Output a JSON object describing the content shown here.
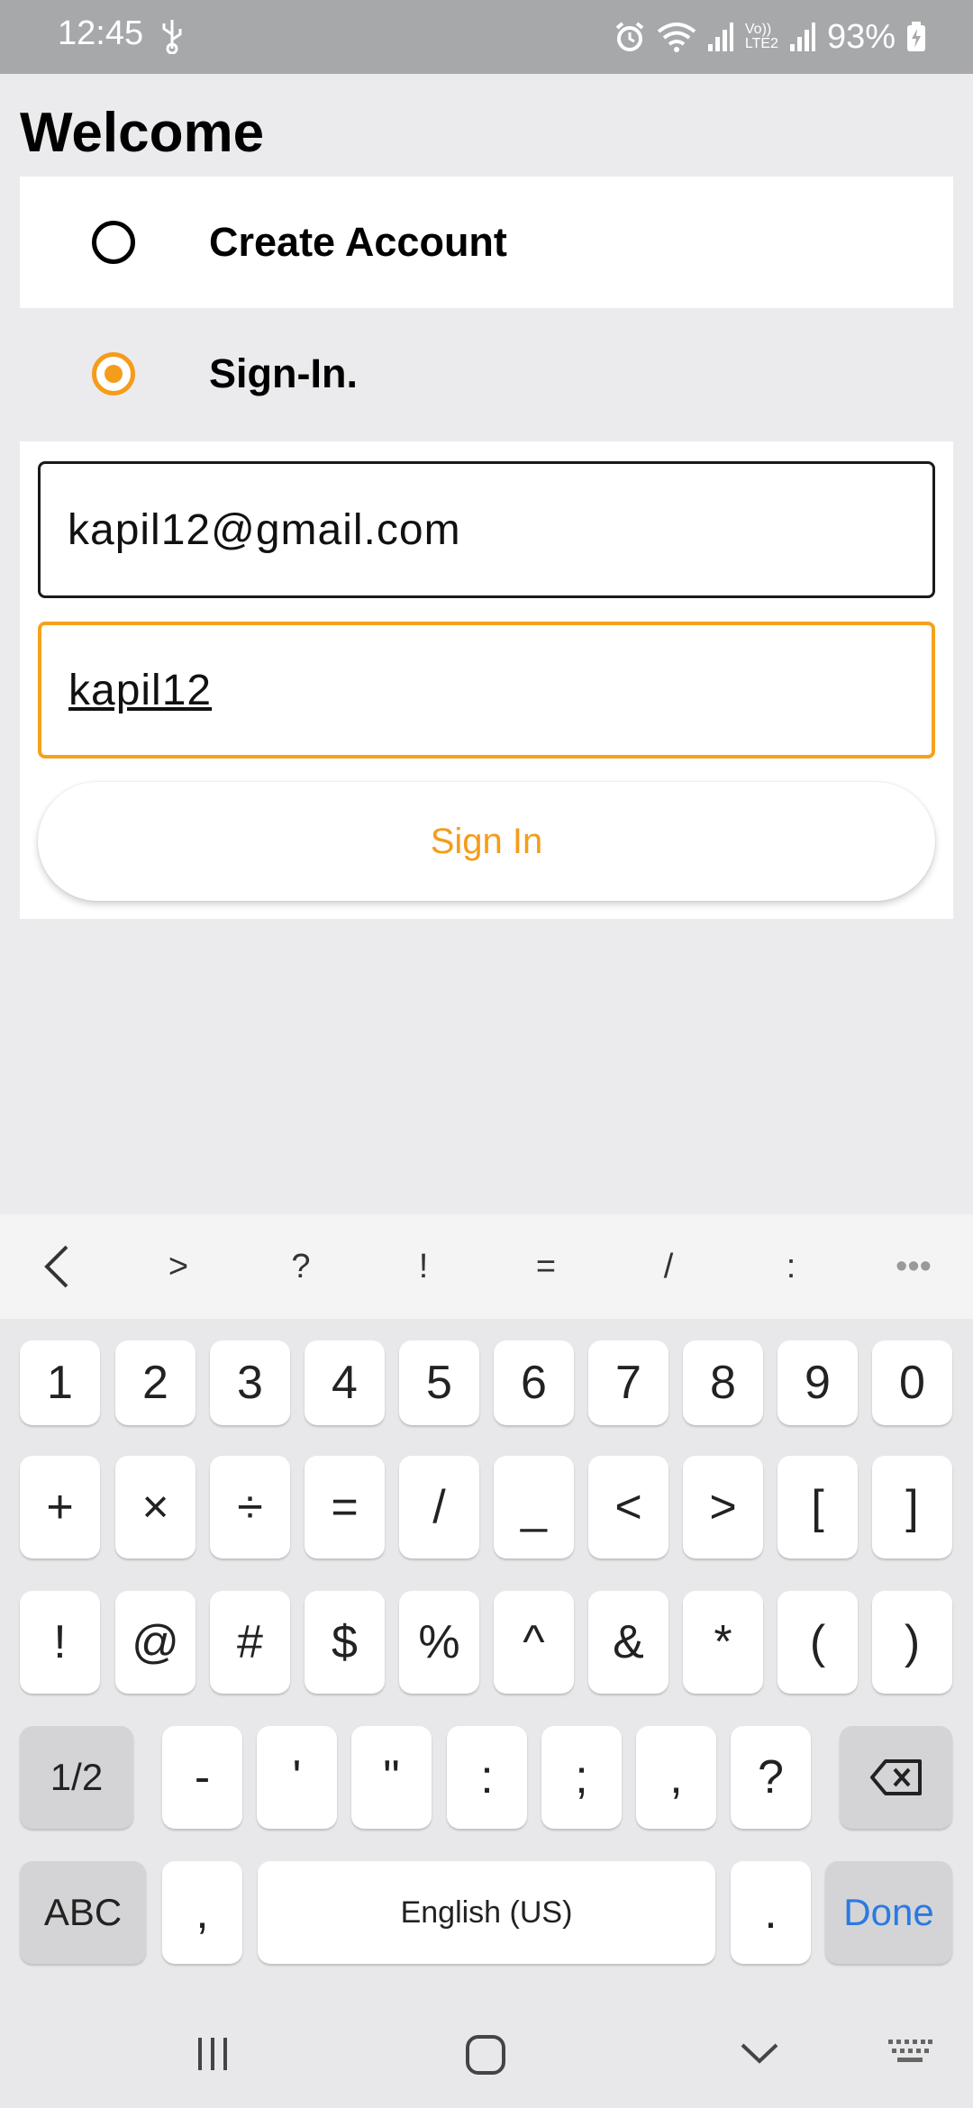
{
  "status_bar": {
    "time": "12:45",
    "battery_percent": "93%",
    "icons": [
      "usb-icon",
      "alarm-icon",
      "wifi-icon",
      "signal-icon",
      "volte-icon",
      "signal-icon",
      "battery-charging-icon"
    ],
    "volte_label": "Vo))",
    "lte_label": "LTE2"
  },
  "page": {
    "title": "Welcome"
  },
  "options": {
    "create_account": {
      "label": "Create Account",
      "selected": false
    },
    "sign_in": {
      "label": "Sign-In.",
      "selected": true
    }
  },
  "form": {
    "email_value": "kapil12@gmail.com",
    "password_value": "kapil12",
    "submit_label": "Sign In"
  },
  "colors": {
    "accent": "#f59c1a",
    "status_bar_bg": "#a7a8aa",
    "page_bg": "#ebebed",
    "keyboard_action": "#2a7ae2"
  },
  "keyboard": {
    "suggestions": [
      "<",
      ">",
      "?",
      "!",
      "=",
      "/",
      ":",
      "•••"
    ],
    "row1": [
      "1",
      "2",
      "3",
      "4",
      "5",
      "6",
      "7",
      "8",
      "9",
      "0"
    ],
    "row2": [
      "+",
      "×",
      "÷",
      "=",
      "/",
      "_",
      "<",
      ">",
      "[",
      "]"
    ],
    "row3": [
      "!",
      "@",
      "#",
      "$",
      "%",
      "^",
      "&",
      "*",
      "(",
      ")"
    ],
    "row4": [
      "1/2",
      "-",
      "'",
      "\"",
      ":",
      ";",
      ",",
      "?"
    ],
    "row5": {
      "abc": "ABC",
      "comma": ",",
      "space": "English (US)",
      "period": ".",
      "done": "Done"
    }
  }
}
